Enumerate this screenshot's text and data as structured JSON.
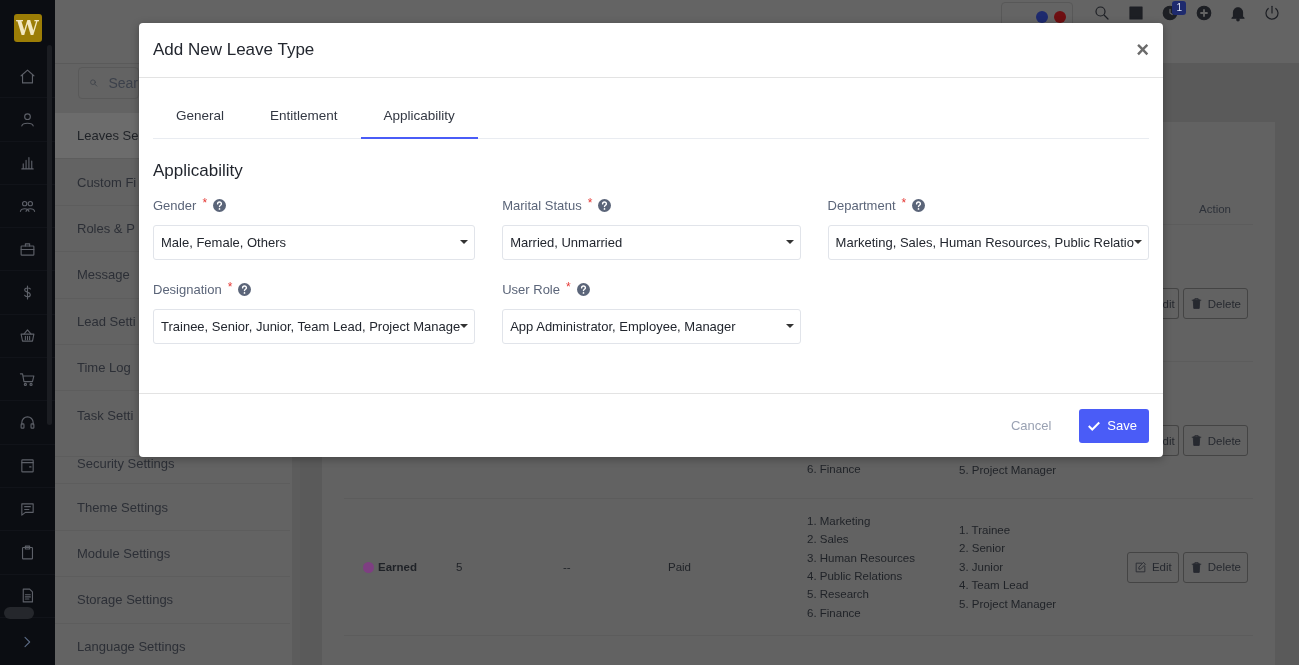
{
  "rail": {
    "logo": "W"
  },
  "header": {
    "badge": "1"
  },
  "settings_menu": {
    "search_placeholder": "Sear",
    "items": [
      {
        "label": "Leaves Se",
        "selected": true
      },
      {
        "label": "Custom Fi",
        "selected": false
      },
      {
        "label": "Roles & P",
        "selected": false
      },
      {
        "label": "Message",
        "selected": false
      },
      {
        "label": "Lead Setti",
        "selected": false
      },
      {
        "label": "Time Log",
        "selected": false
      },
      {
        "label": "Task Setti",
        "selected": false
      },
      {
        "label": "Security Settings",
        "selected": false
      },
      {
        "label": "Theme Settings",
        "selected": false
      },
      {
        "label": "Module Settings",
        "selected": false
      },
      {
        "label": "Storage Settings",
        "selected": false
      },
      {
        "label": "Language Settings",
        "selected": false
      }
    ]
  },
  "table": {
    "action_header": "Action",
    "rows": [
      {
        "actions": [
          {
            "kind": "edit_partial",
            "label": "dit"
          },
          {
            "kind": "delete",
            "label": "Delete"
          }
        ]
      },
      {
        "departments": [
          "6. Finance"
        ],
        "designations": [
          "5. Project Manager"
        ],
        "actions": [
          {
            "kind": "edit_partial",
            "label": "dit"
          },
          {
            "kind": "delete",
            "label": "Delete"
          }
        ]
      },
      {
        "name": "Earned",
        "color": "#7e3f82",
        "days": "5",
        "column_3": "--",
        "type": "Paid",
        "departments": [
          "1. Marketing",
          "2. Sales",
          "3. Human Resources",
          "4. Public Relations",
          "5. Research",
          "6. Finance"
        ],
        "designations": [
          "1. Trainee",
          "2. Senior",
          "3. Junior",
          "4. Team Lead",
          "5. Project Manager"
        ],
        "actions": [
          {
            "kind": "edit",
            "label": "Edit"
          },
          {
            "kind": "delete",
            "label": "Delete"
          }
        ]
      }
    ]
  },
  "modal": {
    "title": "Add New Leave Type",
    "close": "×",
    "tabs": [
      {
        "label": "General",
        "selected": false
      },
      {
        "label": "Entitlement",
        "selected": false
      },
      {
        "label": "Applicability",
        "selected": true
      }
    ],
    "section_title": "Applicability",
    "fields": [
      {
        "label": "Gender",
        "required_mark": "*",
        "value": "Male, Female, Others"
      },
      {
        "label": "Marital Status",
        "required_mark": "*",
        "value": "Married, Unmarried"
      },
      {
        "label": "Department",
        "required_mark": "*",
        "value": "Marketing, Sales, Human Resources, Public Relatio"
      },
      {
        "label": "Designation",
        "required_mark": "*",
        "value": "Trainee, Senior, Junior, Team Lead, Project Manage"
      },
      {
        "label": "User Role",
        "required_mark": "*",
        "value": "App Administrator, Employee, Manager"
      }
    ],
    "buttons": {
      "cancel": "Cancel",
      "save": "Save"
    }
  }
}
